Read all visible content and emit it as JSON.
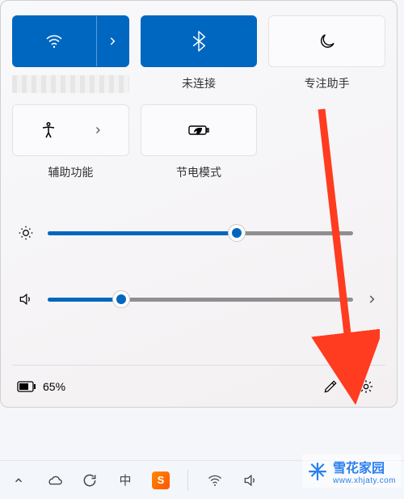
{
  "tiles": {
    "wifi": {
      "label": "",
      "active": true
    },
    "bluetooth": {
      "label": "未连接",
      "active": true
    },
    "focus_assist": {
      "label": "专注助手",
      "active": false
    },
    "accessibility": {
      "label": "辅助功能",
      "active": false
    },
    "battery_saver": {
      "label": "节电模式",
      "active": false
    }
  },
  "sliders": {
    "brightness": {
      "value": 62
    },
    "volume": {
      "value": 24
    }
  },
  "bottom": {
    "battery_pct": "65%"
  },
  "tray": {
    "ime_char": "中",
    "sogou_char": "S"
  },
  "watermark": {
    "title": "雪花家园",
    "sub": "www.xhjaty.com"
  },
  "colors": {
    "accent": "#0067c0"
  }
}
